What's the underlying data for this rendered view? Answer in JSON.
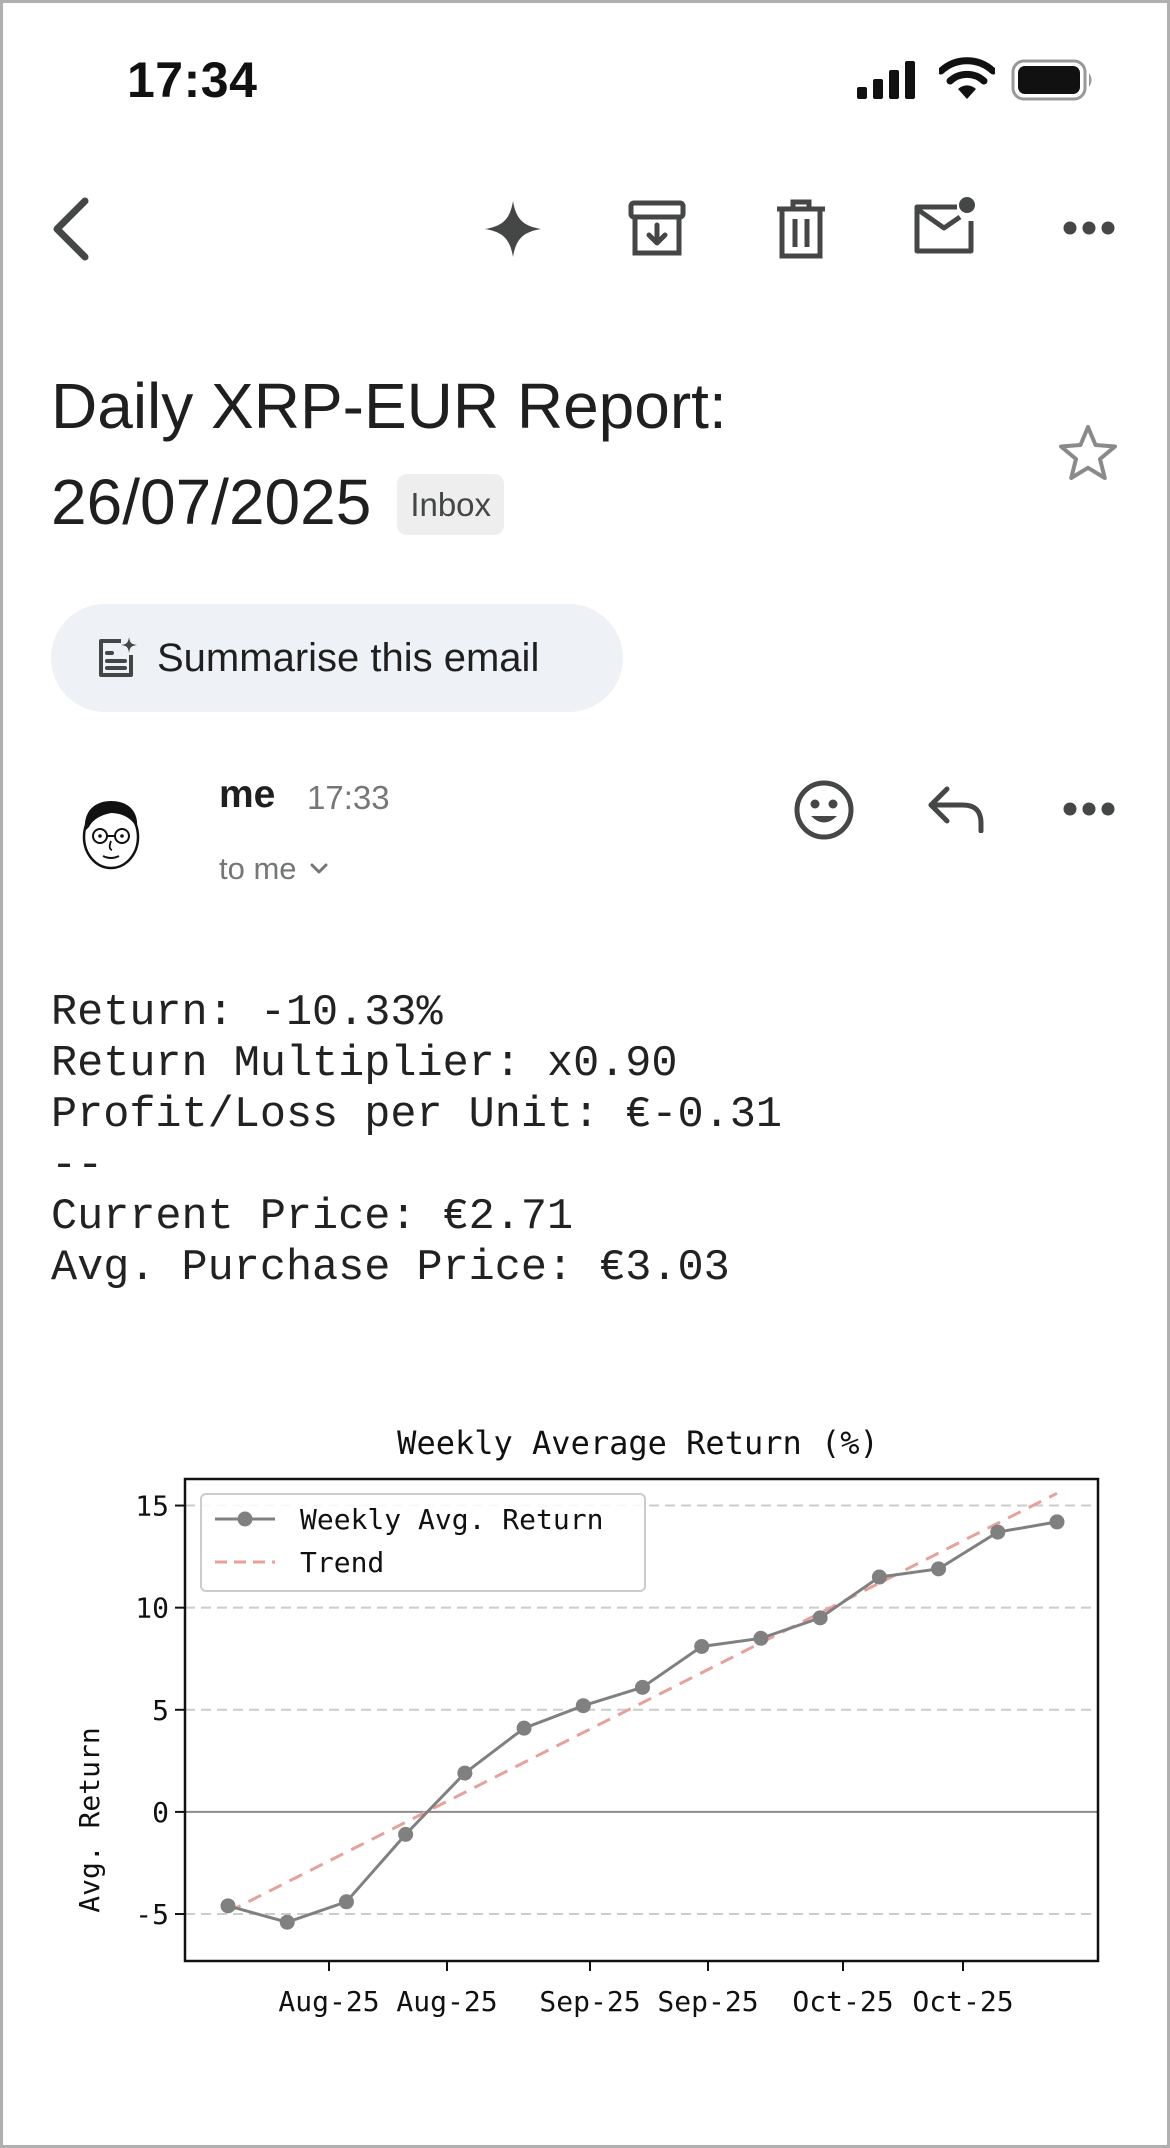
{
  "status_bar": {
    "time": "17:34"
  },
  "toolbar": {
    "icons": [
      "back-arrow-icon",
      "sparkle-icon",
      "archive-icon",
      "trash-icon",
      "mark-unread-icon",
      "more-icon"
    ]
  },
  "email": {
    "subject_line1": "Daily XRP-EUR Report:",
    "subject_line2": "26/07/2025",
    "label_badge": "Inbox",
    "summarise_label": "Summarise this email",
    "sender": "me",
    "sent_time": "17:33",
    "recipient": "to me",
    "body": {
      "return": "Return: -10.33%",
      "multiplier": "Return Multiplier: x0.90",
      "pnl": "Profit/Loss per Unit: €-0.31",
      "separator": "--",
      "current_price": "Current Price: €2.71",
      "avg_price": "Avg. Purchase Price: €3.03"
    }
  },
  "colors": {
    "series_line": "#808080",
    "trend_line": "#e8a199",
    "grid": "#cccccc",
    "star": "#8a8a8a"
  },
  "chart_data": {
    "type": "line",
    "title": "Weekly Average Return (%)",
    "ylabel": "Avg. Return",
    "xlabel": "",
    "ylim": [
      -7.3,
      16.3
    ],
    "yticks": [
      -5,
      0,
      5,
      10,
      15
    ],
    "xticks": [
      "Aug-25",
      "Aug-25",
      "Sep-25",
      "Sep-25",
      "Oct-25",
      "Oct-25"
    ],
    "grid": "horizontal dashed",
    "legend_position": "top-left",
    "series": [
      {
        "name": "Weekly Avg. Return",
        "style": "solid line with circle markers",
        "values": [
          -4.6,
          -5.4,
          -4.4,
          -1.1,
          1.9,
          4.1,
          5.2,
          6.1,
          8.1,
          8.5,
          9.5,
          11.5,
          11.9,
          13.7,
          14.2
        ]
      },
      {
        "name": "Trend",
        "style": "dashed",
        "values": [
          -4.9,
          15.6
        ]
      }
    ]
  }
}
